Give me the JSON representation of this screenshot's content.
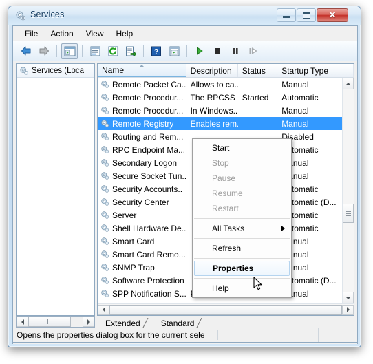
{
  "window": {
    "title": "Services",
    "title_icon": "services-gear-icon",
    "minimize_label": "–",
    "maximize_label": "□",
    "close_label": "✕"
  },
  "menubar": {
    "items": [
      {
        "label": "File",
        "name": "menu-file"
      },
      {
        "label": "Action",
        "name": "menu-action"
      },
      {
        "label": "View",
        "name": "menu-view"
      },
      {
        "label": "Help",
        "name": "menu-help"
      }
    ]
  },
  "toolbar": {
    "buttons": [
      {
        "name": "back-icon",
        "title": "Back"
      },
      {
        "name": "forward-icon",
        "title": "Forward"
      },
      {
        "name": "show-hide-console-tree-icon",
        "title": "Show/Hide Console Tree"
      },
      {
        "name": "properties-icon",
        "title": "Properties"
      },
      {
        "name": "refresh-icon",
        "title": "Refresh"
      },
      {
        "name": "export-list-icon",
        "title": "Export List"
      },
      {
        "name": "help-icon",
        "title": "Help"
      },
      {
        "name": "new-window-icon",
        "title": "New Window"
      },
      {
        "name": "start-service-icon",
        "title": "Start Service"
      },
      {
        "name": "stop-service-icon",
        "title": "Stop Service"
      },
      {
        "name": "pause-service-icon",
        "title": "Pause Service"
      },
      {
        "name": "restart-service-icon",
        "title": "Restart Service"
      }
    ]
  },
  "tree": {
    "root_label": "Services (Loca",
    "root_icon": "services-gear-icon"
  },
  "list": {
    "columns": [
      {
        "label": "Name",
        "sorted": true,
        "sort_direction": "ascending"
      },
      {
        "label": "Description",
        "sorted": false
      },
      {
        "label": "Status",
        "sorted": false
      },
      {
        "label": "Startup Type",
        "sorted": false
      }
    ],
    "rows": [
      {
        "name": "Remote Packet Ca...",
        "description": "Allows to ca...",
        "status": "",
        "startup": "Manual",
        "selected": false
      },
      {
        "name": "Remote Procedur...",
        "description": "The RPCSS ...",
        "status": "Started",
        "startup": "Automatic",
        "selected": false
      },
      {
        "name": "Remote Procedur...",
        "description": "In Windows...",
        "status": "",
        "startup": "Manual",
        "selected": false
      },
      {
        "name": "Remote Registry",
        "description": "Enables rem...",
        "status": "",
        "startup": "Manual",
        "selected": true
      },
      {
        "name": "Routing and Rem...",
        "description": "",
        "status": "",
        "startup": "Disabled",
        "selected": false
      },
      {
        "name": "RPC Endpoint Ma...",
        "description": "",
        "status": "",
        "startup": "Automatic",
        "selected": false
      },
      {
        "name": "Secondary Logon",
        "description": "",
        "status": "",
        "startup": "Manual",
        "selected": false
      },
      {
        "name": "Secure Socket Tun..",
        "description": "",
        "status": "",
        "startup": "Manual",
        "selected": false
      },
      {
        "name": "Security Accounts..",
        "description": "",
        "status": "",
        "startup": "Automatic",
        "selected": false
      },
      {
        "name": "Security Center",
        "description": "",
        "status": "",
        "startup": "Automatic (D...",
        "selected": false
      },
      {
        "name": "Server",
        "description": "",
        "status": "",
        "startup": "Automatic",
        "selected": false
      },
      {
        "name": "Shell Hardware De..",
        "description": "",
        "status": "",
        "startup": "Automatic",
        "selected": false
      },
      {
        "name": "Smart Card",
        "description": "",
        "status": "",
        "startup": "Manual",
        "selected": false
      },
      {
        "name": "Smart Card Remo...",
        "description": "",
        "status": "",
        "startup": "Manual",
        "selected": false
      },
      {
        "name": "SNMP Trap",
        "description": "",
        "status": "",
        "startup": "Manual",
        "selected": false
      },
      {
        "name": "Software Protection",
        "description": "",
        "status": "",
        "startup": "Automatic (D...",
        "selected": false
      },
      {
        "name": "SPP Notification S...",
        "description": "Provides So...",
        "status": "",
        "startup": "Manual",
        "selected": false
      }
    ]
  },
  "context_menu": {
    "items": [
      {
        "label": "Start",
        "enabled": true,
        "bold": false,
        "highlighted": false,
        "submenu": false
      },
      {
        "label": "Stop",
        "enabled": false,
        "bold": false,
        "highlighted": false,
        "submenu": false
      },
      {
        "label": "Pause",
        "enabled": false,
        "bold": false,
        "highlighted": false,
        "submenu": false
      },
      {
        "label": "Resume",
        "enabled": false,
        "bold": false,
        "highlighted": false,
        "submenu": false
      },
      {
        "label": "Restart",
        "enabled": false,
        "bold": false,
        "highlighted": false,
        "submenu": false
      },
      {
        "separator": true
      },
      {
        "label": "All Tasks",
        "enabled": true,
        "bold": false,
        "highlighted": false,
        "submenu": true
      },
      {
        "separator": true
      },
      {
        "label": "Refresh",
        "enabled": true,
        "bold": false,
        "highlighted": false,
        "submenu": false
      },
      {
        "separator": true
      },
      {
        "label": "Properties",
        "enabled": true,
        "bold": true,
        "highlighted": true,
        "submenu": false
      },
      {
        "separator": true
      },
      {
        "label": "Help",
        "enabled": true,
        "bold": false,
        "highlighted": false,
        "submenu": false
      }
    ]
  },
  "tabs": [
    {
      "label": "Extended",
      "active": false
    },
    {
      "label": "Standard",
      "active": true
    }
  ],
  "statusbar": {
    "message": "Opens the properties dialog box for the current sele"
  },
  "colors": {
    "selection_blue": "#3399ff",
    "title_text": "#123a5e",
    "close_red": "#c4322a",
    "accent_border": "#7ab4e0"
  }
}
